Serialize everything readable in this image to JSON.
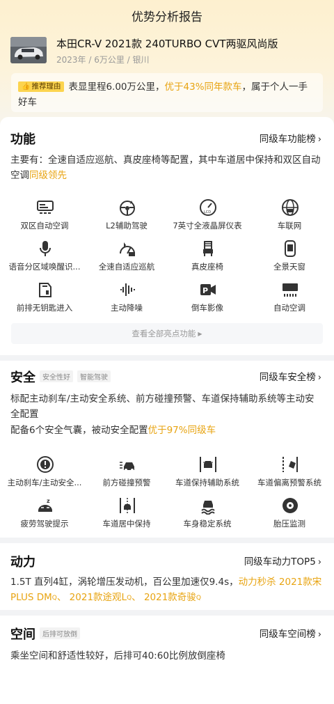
{
  "header": {
    "title": "优势分析报告"
  },
  "car": {
    "name": "本田CR-V 2021款 240TURBO CVT两驱风尚版",
    "meta": "2023年 / 6万公里 / 银川"
  },
  "reason": {
    "tag": "推荐理由",
    "text_before": "表显里程6.00万公里，",
    "highlight": "优于43%同年款车",
    "text_after": "，属于个人一手好车"
  },
  "function_section": {
    "title": "功能",
    "link": "同级车功能榜",
    "desc_text": "主要有：全速自适应巡航、真皮座椅等配置，其中车道居中保持和双区自动空调",
    "desc_highlight": "同级领先",
    "items": [
      {
        "label": "双区自动空调",
        "icon": "dual-zone-ac-icon"
      },
      {
        "label": "L2辅助驾驶",
        "icon": "steering-wheel-icon"
      },
      {
        "label": "7英寸全液晶屏仪表",
        "icon": "lcd-gauge-icon"
      },
      {
        "label": "车联网",
        "icon": "connected-car-icon"
      },
      {
        "label": "语音分区域唤醒识...",
        "icon": "microphone-icon"
      },
      {
        "label": "全速自适应巡航",
        "icon": "cruise-control-icon"
      },
      {
        "label": "真皮座椅",
        "icon": "leather-seat-icon"
      },
      {
        "label": "全景天窗",
        "icon": "panoramic-sunroof-icon"
      },
      {
        "label": "前排无钥匙进入",
        "icon": "keyless-entry-icon"
      },
      {
        "label": "主动降噪",
        "icon": "noise-cancel-icon"
      },
      {
        "label": "倒车影像",
        "icon": "reverse-camera-icon"
      },
      {
        "label": "自动空调",
        "icon": "auto-ac-icon"
      }
    ],
    "view_all": "查看全部亮点功能"
  },
  "safety_section": {
    "title": "安全",
    "chips": [
      "安全性好",
      "智能驾驶"
    ],
    "link": "同级车安全榜",
    "desc1": "标配主动刹车/主动安全系统、前方碰撞预警、车道保持辅助系统等主动安全配置",
    "desc2_text": "配备6个安全气囊，被动安全配置",
    "desc2_highlight": "优于97%同级车",
    "items": [
      {
        "label": "主动刹车/主动安全...",
        "icon": "active-brake-icon"
      },
      {
        "label": "前方碰撞预警",
        "icon": "collision-warning-icon"
      },
      {
        "label": "车道保持辅助系统",
        "icon": "lane-keep-icon"
      },
      {
        "label": "车道偏离预警系统",
        "icon": "lane-departure-icon"
      },
      {
        "label": "疲劳驾驶提示",
        "icon": "fatigue-icon"
      },
      {
        "label": "车道居中保持",
        "icon": "lane-center-icon"
      },
      {
        "label": "车身稳定系统",
        "icon": "stability-icon"
      },
      {
        "label": "胎压监测",
        "icon": "tire-pressure-icon"
      }
    ]
  },
  "power_section": {
    "title": "动力",
    "link": "同级车动力TOP5",
    "desc_text": "1.5T 直列4缸，涡轮增压发动机，百公里加速仅9.4s，",
    "desc_highlight": "动力秒杀",
    "rivals": [
      "2021款宋PLUS DM",
      "2021款途观L",
      "2021款奇骏"
    ],
    "separator": "、"
  },
  "space_section": {
    "title": "空间",
    "chip": "后排可放倒",
    "link": "同级车空间榜",
    "desc": "乘坐空间和舒适性较好，后排可40:60比例放倒座椅"
  },
  "colors": {
    "accent": "#e8a412",
    "tag_bg": "#fcd44f",
    "hero_bg": "#fdf0cf"
  }
}
